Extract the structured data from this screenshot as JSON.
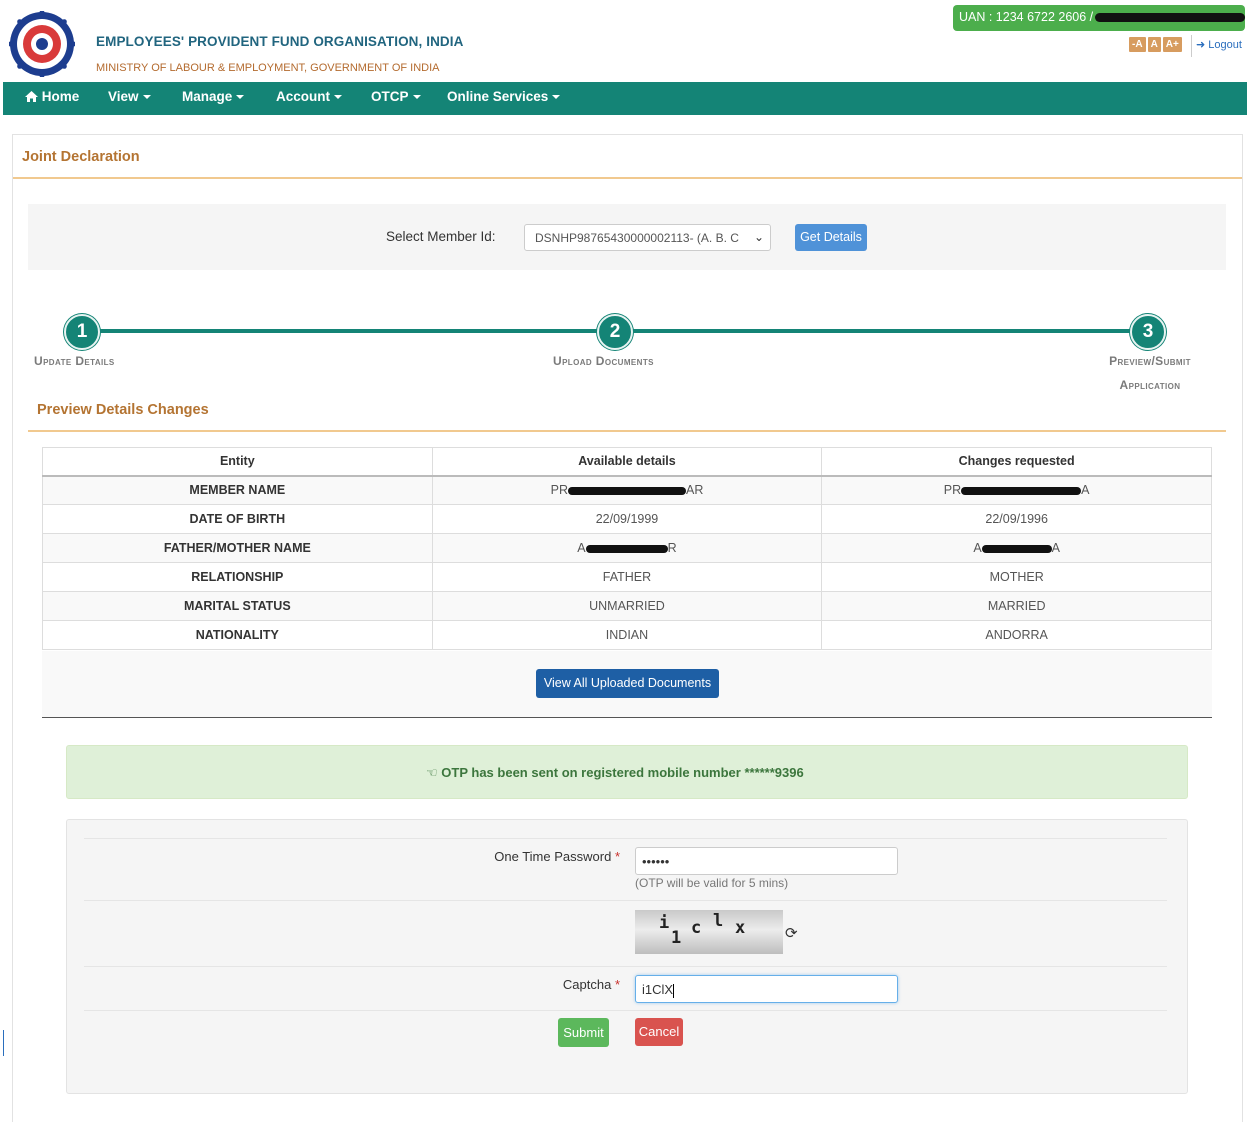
{
  "header": {
    "org_name": "EMPLOYEES' PROVIDENT FUND ORGANISATION, INDIA",
    "ministry": "MINISTRY OF LABOUR & EMPLOYMENT, GOVERNMENT OF INDIA",
    "uan": "UAN : 1234 6722 2606 /",
    "font_controls": [
      "-A",
      "A",
      "A+"
    ],
    "logout": "Logout"
  },
  "nav": {
    "home": "Home",
    "items": [
      "View",
      "Manage",
      "Account",
      "OTCP",
      "Online Services"
    ]
  },
  "page": {
    "title": "Joint Declaration"
  },
  "member_select": {
    "label": "Select Member Id:",
    "value": "DSNHP98765430000002113- (A. B. C",
    "button": "Get Details"
  },
  "stepper": {
    "steps": [
      {
        "number": "1",
        "label_line1": "Update Details",
        "label_line2": ""
      },
      {
        "number": "2",
        "label_line1": "Upload Documents",
        "label_line2": ""
      },
      {
        "number": "3",
        "label_line1": "Preview/Submit",
        "label_line2": "Application"
      }
    ]
  },
  "preview": {
    "title": "Preview Details Changes",
    "headers": [
      "Entity",
      "Available details",
      "Changes requested"
    ],
    "rows": [
      {
        "entity": "MEMBER NAME",
        "available": "PR",
        "available_end": "AR",
        "changes": "PR",
        "changes_end": "A"
      },
      {
        "entity": "DATE OF BIRTH",
        "available": "22/09/1999",
        "changes": "22/09/1996"
      },
      {
        "entity": "FATHER/MOTHER NAME",
        "available": "A",
        "available_end": "R",
        "changes": "A",
        "changes_end": "A"
      },
      {
        "entity": "RELATIONSHIP",
        "available": "FATHER",
        "changes": "MOTHER"
      },
      {
        "entity": "MARITAL STATUS",
        "available": "UNMARRIED",
        "changes": "MARRIED"
      },
      {
        "entity": "NATIONALITY",
        "available": "INDIAN",
        "changes": "ANDORRA"
      }
    ],
    "view_docs_button": "View All Uploaded Documents"
  },
  "otp": {
    "alert": "OTP has been sent on registered mobile number ******9396",
    "password_label": "One Time Password",
    "password_value": "••••••",
    "hint": "(OTP will be valid for 5 mins)",
    "captcha_chars": [
      "i",
      "1",
      "c",
      "l",
      "x"
    ],
    "captcha_label": "Captcha",
    "captcha_value": "i1ClX",
    "required_mark": "*",
    "submit": "Submit",
    "cancel": "Cancel"
  },
  "colors": {
    "nav_bg": "#148476",
    "brand_blue": "#21657f",
    "accent_orange": "#b47432",
    "success": "#5cb85c",
    "danger": "#d9534f",
    "primary": "#1e5fa5"
  },
  "icons": {
    "home": "home-icon",
    "logout": "sign-out-icon",
    "alert": "hand-pointing-icon",
    "refresh": "refresh-icon",
    "select": "chevron-down-icon"
  }
}
